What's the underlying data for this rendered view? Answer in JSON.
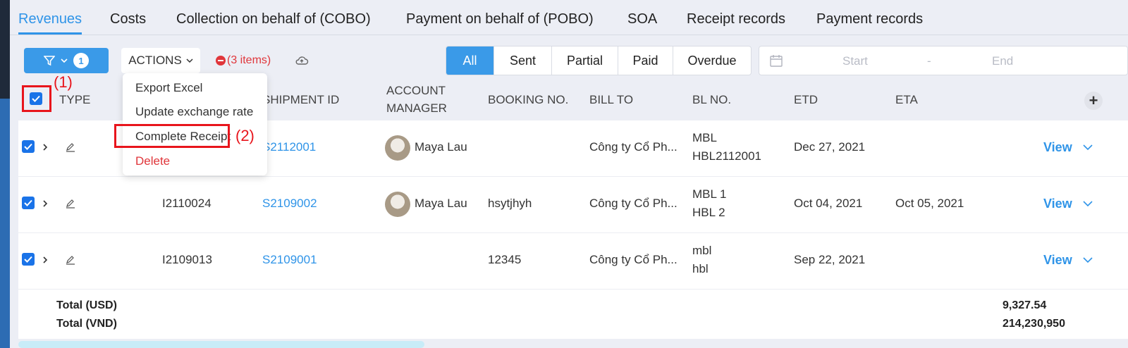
{
  "tabs": [
    {
      "label": "Revenues",
      "active": true
    },
    {
      "label": "Costs"
    },
    {
      "label": "Collection on behalf of (COBO)"
    },
    {
      "label": "Payment on behalf of (POBO)"
    },
    {
      "label": "SOA"
    },
    {
      "label": "Receipt records"
    },
    {
      "label": "Payment records"
    }
  ],
  "toolbar": {
    "filter_count": "1",
    "actions_label": "ACTIONS",
    "items_selected": "(3 items)",
    "status_filters": [
      "All",
      "Sent",
      "Partial",
      "Paid",
      "Overdue"
    ],
    "date_start": "Start",
    "date_sep": "-",
    "date_end": "End"
  },
  "actions_menu": {
    "items": [
      "Export Excel",
      "Update exchange rate",
      "Complete Receipt",
      "Delete"
    ]
  },
  "annotations": {
    "one": "(1)",
    "two": "(2)"
  },
  "table": {
    "headers": {
      "type": "TYPE",
      "shipment_id": "SHIPMENT ID",
      "account_manager_1": "ACCOUNT",
      "account_manager_2": "MANAGER",
      "booking_no": "BOOKING NO.",
      "bill_to": "BILL TO",
      "bl_no": "BL NO.",
      "etd": "ETD",
      "eta": "ETA"
    },
    "rows": [
      {
        "code": "",
        "shipment": "S2112001",
        "manager": "Maya Lau",
        "booking": "",
        "bill_to": "Công ty Cổ Ph...",
        "bl1": "MBL",
        "bl2": "HBL2112001",
        "etd": "Dec 27, 2021",
        "eta": "",
        "view": "View"
      },
      {
        "code": "I2110024",
        "shipment": "S2109002",
        "manager": "Maya Lau",
        "booking": "hsytjhyh",
        "bill_to": "Công ty Cổ Ph...",
        "bl1": "MBL 1",
        "bl2": "HBL 2",
        "etd": "Oct 04, 2021",
        "eta": "Oct 05, 2021",
        "view": "View"
      },
      {
        "code": "I2109013",
        "shipment": "S2109001",
        "manager": "",
        "booking": "12345",
        "bill_to": "Công ty Cổ Ph...",
        "bl1": "mbl",
        "bl2": "hbl",
        "etd": "Sep 22, 2021",
        "eta": "",
        "view": "View"
      }
    ],
    "totals": {
      "usd_label": "Total (USD)",
      "usd_value": "9,327.54",
      "vnd_label": "Total (VND)",
      "vnd_value": "214,230,950"
    }
  },
  "colors": {
    "accent": "#2f94e8",
    "danger": "#e0363b",
    "annotation": "#e8151c"
  }
}
